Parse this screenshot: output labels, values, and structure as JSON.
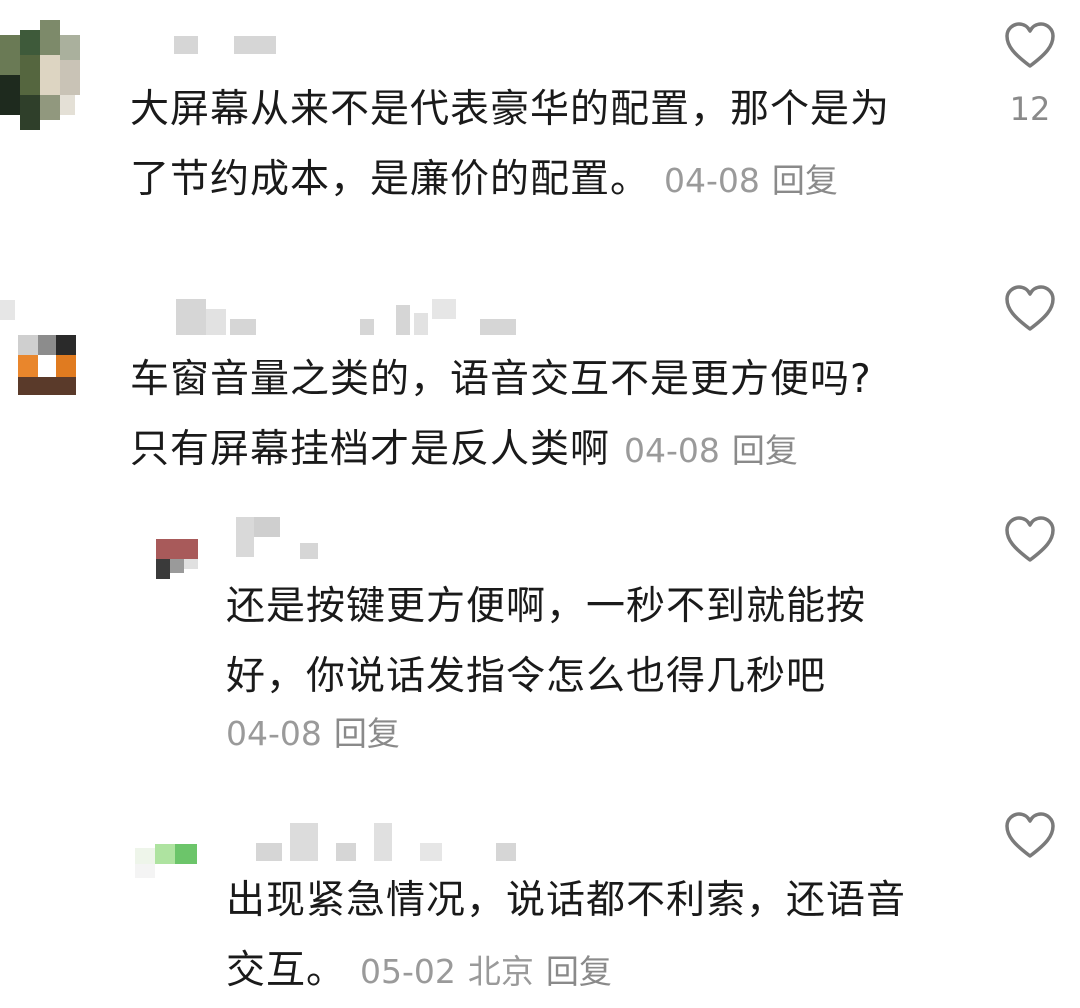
{
  "comments": [
    {
      "text_line1": "大屏幕从来不是代表豪华的配置，那个是为",
      "text_line2": "了节约成本，是廉价的配置。",
      "date": "04-08",
      "reply": "回复",
      "likes": "12"
    },
    {
      "text_line1": "车窗音量之类的，语音交互不是更方便吗?",
      "text_line2": "只有屏幕挂档才是反人类啊",
      "date": "04-08",
      "reply": "回复",
      "likes": ""
    },
    {
      "text_line1": "还是按键更方便啊，一秒不到就能按",
      "text_line2": "好，你说话发指令怎么也得几秒吧",
      "date": "04-08",
      "reply": "回复",
      "likes": ""
    },
    {
      "text_line1": "出现紧急情况，说话都不利索，还语音",
      "text_line2": "交互。",
      "date": "05-02",
      "location": "北京",
      "reply": "回复",
      "likes": ""
    }
  ],
  "icons": {
    "like": "heart-outline-icon"
  },
  "colors": {
    "text": "#1a1a1a",
    "meta": "#9a9a9a",
    "icon": "#7a7a7a"
  }
}
